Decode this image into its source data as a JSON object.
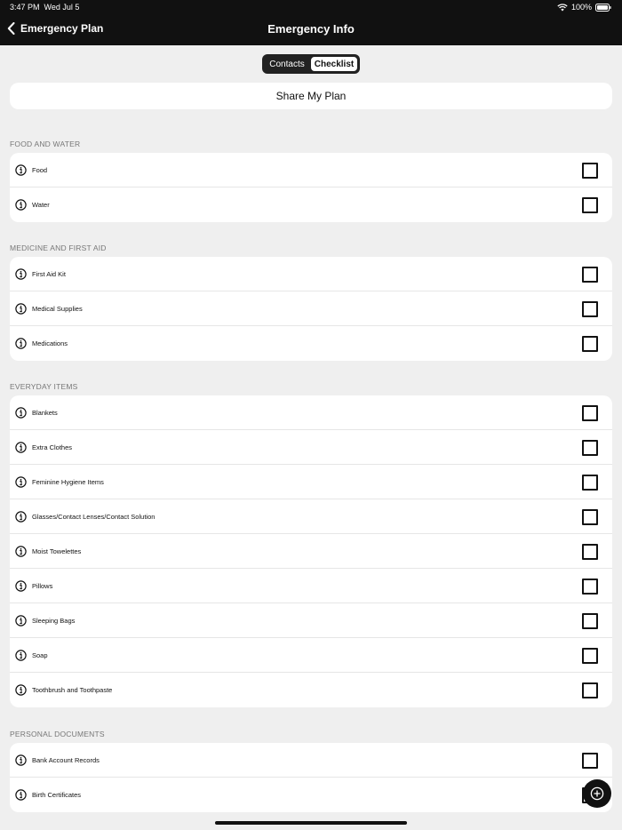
{
  "status": {
    "time": "3:47 PM",
    "date": "Wed Jul 5",
    "battery": "100%"
  },
  "nav": {
    "back_label": "Emergency Plan",
    "title": "Emergency Info"
  },
  "tabs": [
    {
      "label": "Contacts",
      "active": false
    },
    {
      "label": "Checklist",
      "active": true
    }
  ],
  "share_label": "Share My Plan",
  "sections": [
    {
      "title": "FOOD AND WATER",
      "items": [
        "Food",
        "Water"
      ]
    },
    {
      "title": "MEDICINE AND FIRST AID",
      "items": [
        "First Aid Kit",
        "Medical Supplies",
        "Medications"
      ]
    },
    {
      "title": "EVERYDAY ITEMS",
      "items": [
        "Blankets",
        "Extra Clothes",
        "Feminine Hygiene Items",
        "Glasses/Contact Lenses/Contact Solution",
        "Moist Towelettes",
        "Pillows",
        "Sleeping Bags",
        "Soap",
        "Toothbrush and Toothpaste"
      ]
    },
    {
      "title": "PERSONAL DOCUMENTS",
      "items": [
        "Bank Account Records",
        "Birth Certificates"
      ]
    }
  ],
  "colors": {
    "header_bg": "#111111",
    "page_bg": "#efefef",
    "card_bg": "#ffffff"
  },
  "icons": {
    "info": "info-circle-icon",
    "add": "plus-circle-icon",
    "back": "chevron-left-icon"
  }
}
